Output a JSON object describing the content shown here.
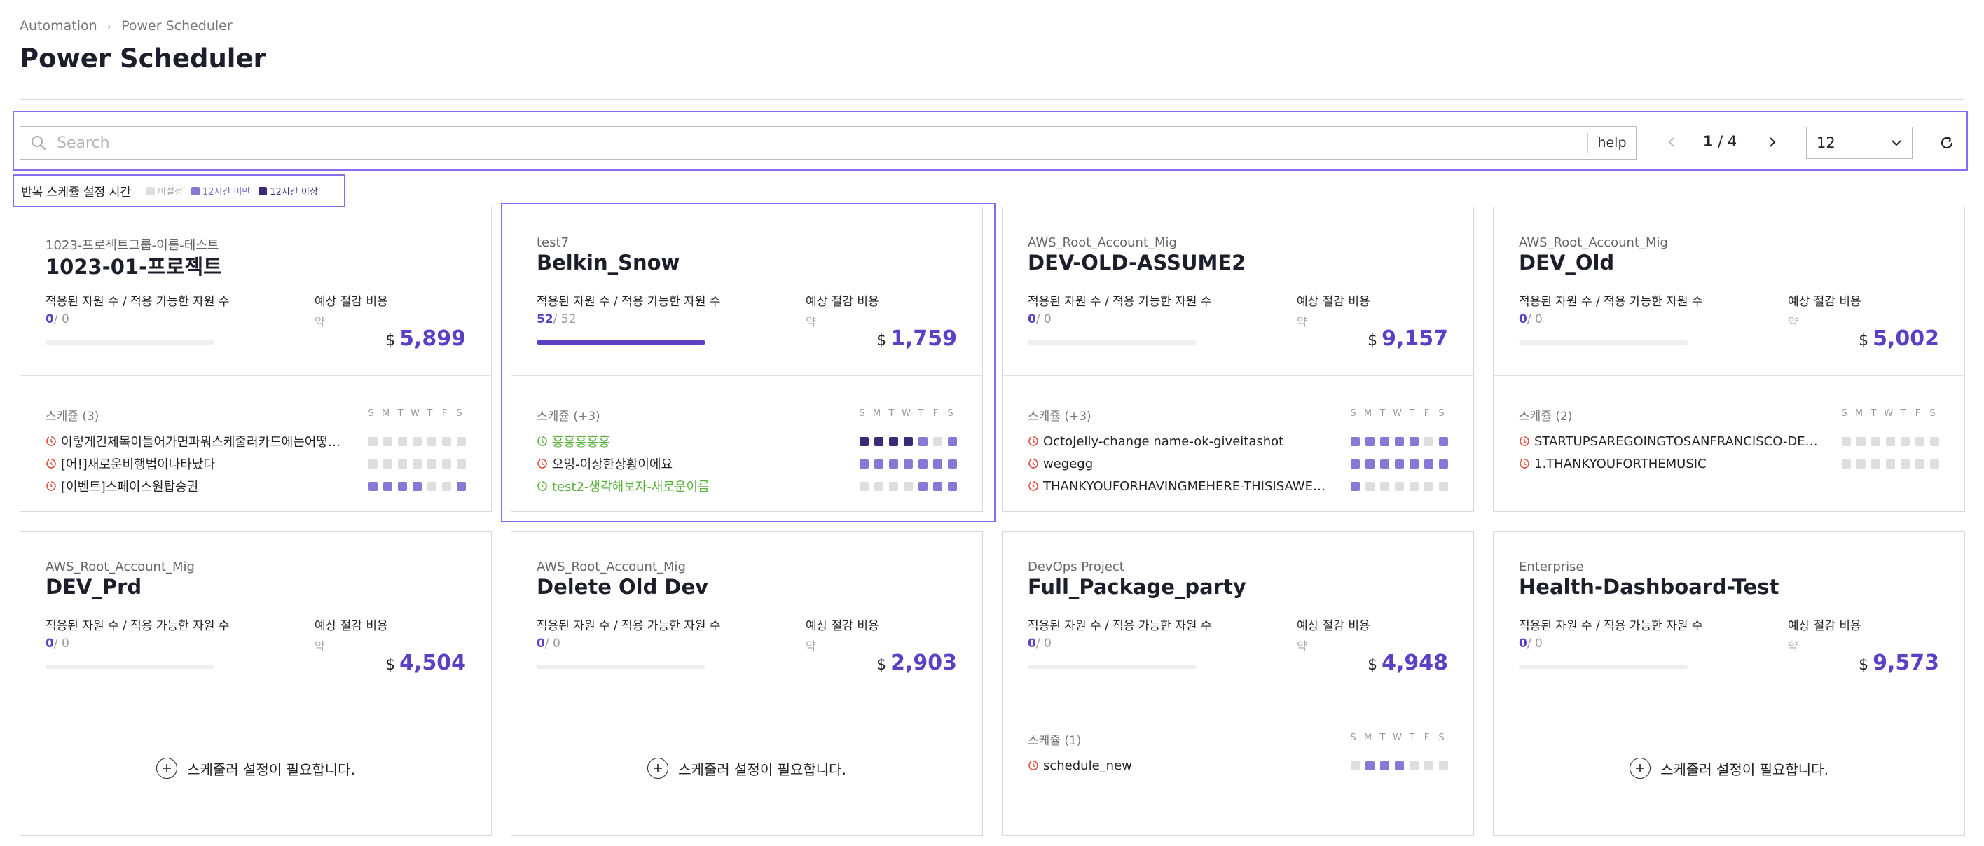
{
  "breadcrumb": [
    "Automation",
    "Power Scheduler"
  ],
  "page_title": "Power Scheduler",
  "search": {
    "placeholder": "Search",
    "value": "",
    "help_label": "help"
  },
  "pagination": {
    "current": "1",
    "total": "4",
    "page_size": "12"
  },
  "legend": {
    "title": "반복 스케쥴 설정 시간",
    "items": [
      {
        "label": "미설정",
        "color": "#dedede",
        "text_color": "#aaaaaa"
      },
      {
        "label": "12시간 미만",
        "color": "#8878d6",
        "text_color": "#7a69d0"
      },
      {
        "label": "12시간 이상",
        "color": "#3a2a78",
        "text_color": "#3a2a78"
      }
    ]
  },
  "colors": {
    "none": "#dedede",
    "under12": "#8878d6",
    "over12": "#3a2a78",
    "accent": "#5b3fc4",
    "selection": "#8b6cf0"
  },
  "labels": {
    "resources": "적용된 자원 수 / 적용 가능한 자원 수",
    "savings": "예상 절감 비용",
    "approx": "약",
    "currency": "$",
    "schedule": "스케쥴",
    "days": [
      "S",
      "M",
      "T",
      "W",
      "T",
      "F",
      "S"
    ],
    "empty": "스케줄러 설정이 필요합니다."
  },
  "cards": [
    {
      "group": "1023-프로젝트그룹-이름-테스트",
      "name": "1023-01-프로젝트",
      "applied": "0",
      "total": "/ 0",
      "progress": 0,
      "amount": "5,899",
      "schedule_count": "(3)",
      "schedules": [
        {
          "name": "이렇게긴제목이들어가면파워스케줄러카드에는어떻게보일까요",
          "state": "off",
          "days": [
            0,
            0,
            0,
            0,
            0,
            0,
            0
          ]
        },
        {
          "name": "[어!]새로운비행법이나타났다",
          "state": "off",
          "days": [
            0,
            0,
            0,
            0,
            0,
            0,
            0
          ]
        },
        {
          "name": "[이벤트]스페이스원탑승권",
          "state": "off",
          "days": [
            1,
            1,
            1,
            1,
            0,
            0,
            1
          ]
        }
      ]
    },
    {
      "group": "test7",
      "name": "Belkin_Snow",
      "applied": "52",
      "total": "/ 52",
      "progress": 1,
      "amount": "1,759",
      "schedule_count": "(+3)",
      "schedules": [
        {
          "name": "홍홍홍홍홍",
          "state": "on",
          "days": [
            2,
            2,
            2,
            2,
            1,
            0,
            1
          ]
        },
        {
          "name": "오잉-이상한상황이에요",
          "state": "off",
          "days": [
            1,
            1,
            1,
            1,
            1,
            1,
            1
          ]
        },
        {
          "name": "test2-생각해보자-새로운이름",
          "state": "on",
          "days": [
            0,
            0,
            0,
            0,
            1,
            1,
            1
          ]
        }
      ]
    },
    {
      "group": "AWS_Root_Account_Mig",
      "name": "DEV-OLD-ASSUME2",
      "applied": "0",
      "total": "/ 0",
      "progress": 0,
      "amount": "9,157",
      "schedule_count": "(+3)",
      "schedules": [
        {
          "name": "OctoJelly-change name-ok-giveitashot",
          "state": "off",
          "days": [
            1,
            1,
            1,
            1,
            1,
            0,
            1
          ]
        },
        {
          "name": "wegegg",
          "state": "off",
          "days": [
            1,
            1,
            1,
            1,
            1,
            1,
            1
          ]
        },
        {
          "name": "THANKYOUFORHAVINGMEHERE-THISISAWESOME",
          "state": "off",
          "days": [
            1,
            0,
            0,
            0,
            0,
            0,
            0
          ]
        }
      ]
    },
    {
      "group": "AWS_Root_Account_Mig",
      "name": "DEV_Old",
      "applied": "0",
      "total": "/ 0",
      "progress": 0,
      "amount": "5,002",
      "schedule_count": "(2)",
      "schedules": [
        {
          "name": "STARTUPSAREGOINGTOSANFRANCISCO-DESIGNWEEK",
          "state": "off",
          "days": [
            0,
            0,
            0,
            0,
            0,
            0,
            0
          ]
        },
        {
          "name": "1.THANKYOUFORTHEMUSIC",
          "state": "off",
          "days": [
            0,
            0,
            0,
            0,
            0,
            0,
            0
          ]
        }
      ]
    },
    {
      "group": "AWS_Root_Account_Mig",
      "name": "DEV_Prd",
      "applied": "0",
      "total": "/ 0",
      "progress": 0,
      "amount": "4,504",
      "schedules": []
    },
    {
      "group": "AWS_Root_Account_Mig",
      "name": "Delete Old Dev",
      "applied": "0",
      "total": "/ 0",
      "progress": 0,
      "amount": "2,903",
      "schedules": []
    },
    {
      "group": "DevOps Project",
      "name": "Full_Package_party",
      "applied": "0",
      "total": "/ 0",
      "progress": 0,
      "amount": "4,948",
      "schedule_count": "(1)",
      "schedules": [
        {
          "name": "schedule_new",
          "state": "off",
          "days": [
            0,
            1,
            1,
            1,
            0,
            0,
            0
          ]
        }
      ]
    },
    {
      "group": "Enterprise",
      "name": "Health-Dashboard-Test",
      "applied": "0",
      "total": "/ 0",
      "progress": 0,
      "amount": "9,573",
      "schedules": []
    }
  ]
}
